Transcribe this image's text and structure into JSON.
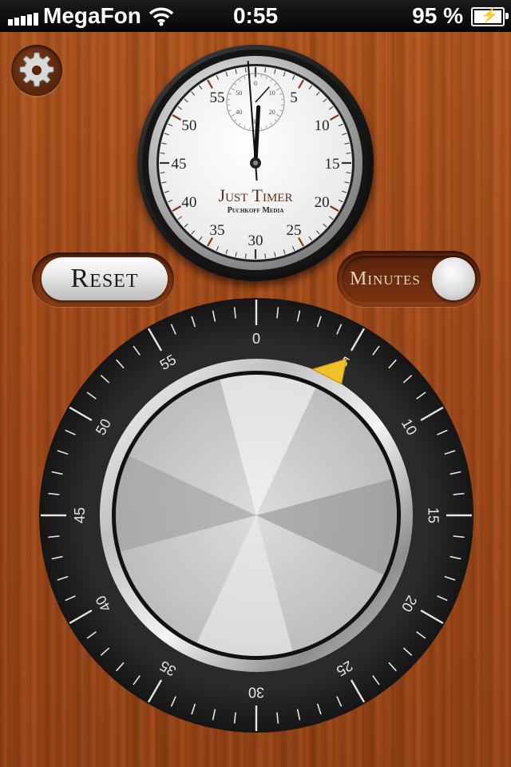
{
  "status_bar": {
    "carrier": "MegaFon",
    "time": "0:55",
    "battery_percent": "95 %",
    "signal_bars": 5,
    "wifi_icon": "wifi-icon",
    "battery_icon": "battery-charging-icon"
  },
  "toolbar": {
    "settings_icon": "gear-icon"
  },
  "stopwatch": {
    "brand": "Just Timer",
    "maker": "Puchkoff Media",
    "main_labels": [
      "55",
      "5",
      "50",
      "10",
      "45",
      "15",
      "40",
      "20",
      "35",
      "25",
      "30"
    ],
    "sub_labels": [
      "50",
      "0",
      "10",
      "40",
      "20",
      "30"
    ],
    "minute_hand_value": 0.5,
    "second_hand_value": 59.3,
    "sub_hand_value": 7
  },
  "controls": {
    "reset_label": "Reset",
    "mode_label": "Minutes",
    "mode_on": true
  },
  "dial": {
    "labels": [
      "0",
      "5",
      "10",
      "15",
      "20",
      "25",
      "30",
      "35",
      "40",
      "45",
      "50",
      "55"
    ],
    "pointer_value": 5,
    "colors": {
      "ring": "#1c1c1c",
      "pointer": "#f2c029"
    }
  }
}
